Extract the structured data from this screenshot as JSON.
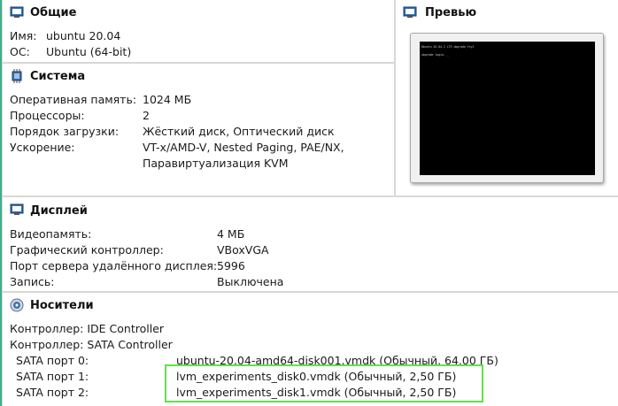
{
  "general": {
    "title": "Общие",
    "icon": "monitor-icon",
    "name_label": "Имя:",
    "name_value": "ubuntu 20.04",
    "os_label": "ОС:",
    "os_value": "Ubuntu (64-bit)"
  },
  "preview": {
    "title": "Превью",
    "icon": "monitor-icon",
    "console_line1": "Ubuntu 20.04.2 LTS ubgrade tty1",
    "console_line2": "ubgrade login: _"
  },
  "system": {
    "title": "Система",
    "icon": "chip-icon",
    "rows": [
      {
        "label": "Оперативная память:",
        "value": "1024 МБ"
      },
      {
        "label": "Процессоры:",
        "value": "2"
      },
      {
        "label": "Порядок загрузки:",
        "value": "Жёсткий диск, Оптический диск"
      },
      {
        "label": "Ускорение:",
        "value": "VT-x/AMD-V, Nested Paging, PAE/NX,"
      }
    ],
    "accel_line2": "Паравиртуализация KVM"
  },
  "display": {
    "title": "Дисплей",
    "icon": "monitor-icon",
    "rows": [
      {
        "label": "Видеопамять:",
        "value": "4 МБ"
      },
      {
        "label": "Графический контроллер:",
        "value": "VBoxVGA"
      },
      {
        "label": "Порт сервера удалённого дисплея:",
        "value": "5996"
      },
      {
        "label": "Запись:",
        "value": "Выключена"
      }
    ]
  },
  "storage": {
    "title": "Носители",
    "icon": "disk-icon",
    "controllers": [
      "Контроллер: IDE Controller",
      "Контроллер: SATA Controller"
    ],
    "ports": [
      {
        "label": "SATA порт 0:",
        "value": "ubuntu-20.04-amd64-disk001.vmdk (Обычный, 64,00 ГБ)"
      },
      {
        "label": "SATA порт 1:",
        "value": "lvm_experiments_disk0.vmdk (Обычный, 2,50 ГБ)"
      },
      {
        "label": "SATA порт 2:",
        "value": "lvm_experiments_disk1.vmdk (Обычный, 2,50 ГБ)"
      }
    ]
  },
  "colors": {
    "highlight": "#5fe24a",
    "accent_left": "#3daf8a"
  }
}
